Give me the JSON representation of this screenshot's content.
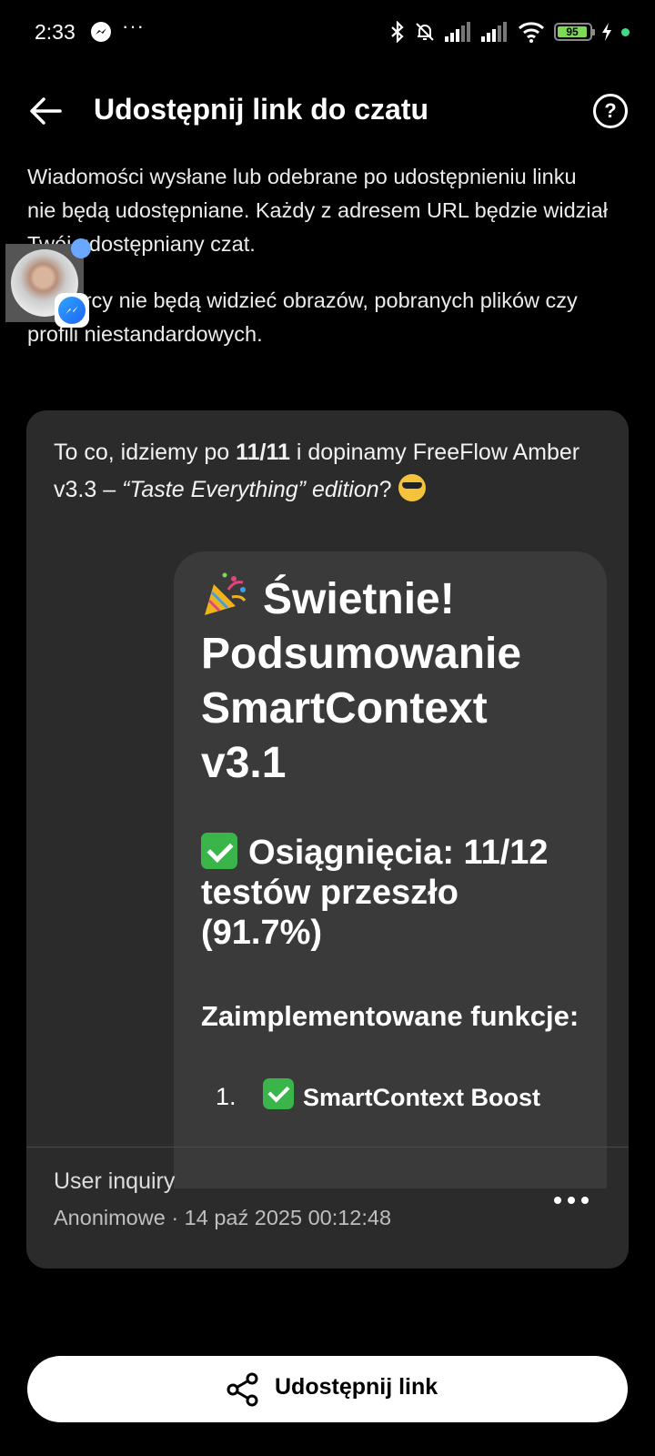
{
  "status_bar": {
    "time": "2:33",
    "more_dots": "···",
    "battery_level": "95",
    "icons": [
      "messenger-icon",
      "bluetooth-icon",
      "bell-muted-icon",
      "signal-icon",
      "signal-icon",
      "wifi-icon",
      "battery-icon",
      "charging-icon"
    ]
  },
  "header": {
    "title": "Udostępnij link do czatu",
    "help_label": "?"
  },
  "info": {
    "paragraph1": "Wiadomości wysłane lub odebrane po udostępnieniu linku nie będą udostępniane. Każdy z adresem URL będzie widział Twój udostępniany czat.",
    "paragraph2": "Odbiorcy nie będą widzieć obrazów, pobranych plików czy profili niestandardowych."
  },
  "chat": {
    "user_message": {
      "part1": "To co, idziemy po ",
      "bold": "11/11",
      "part2": " i dopinamy FreeFlow Amber v3.3 – ",
      "italic_quote": "“Taste Everything”",
      "italic_edition": " edition",
      "part3": "?"
    },
    "ai_message": {
      "title": "Świetnie! Podsumowanie SmartContext v3.1",
      "achievements": "Osiągnięcia: 11/12 testów przeszło (91.7%)",
      "features_heading": "Zaimplementowane funkcje:",
      "list_item_number": "1.",
      "list_item_text": "SmartContext Boost"
    },
    "meta_title": "User inquiry",
    "meta_subtitle": "Anonimowe · 14 paź 2025 00:12:48"
  },
  "share_button": {
    "label": "Udostępnij link"
  },
  "colors": {
    "background": "#000000",
    "card": "#2b2b2b",
    "ai_bubble": "#3a3a3a",
    "battery": "#7ed957",
    "check": "#39b54a"
  }
}
